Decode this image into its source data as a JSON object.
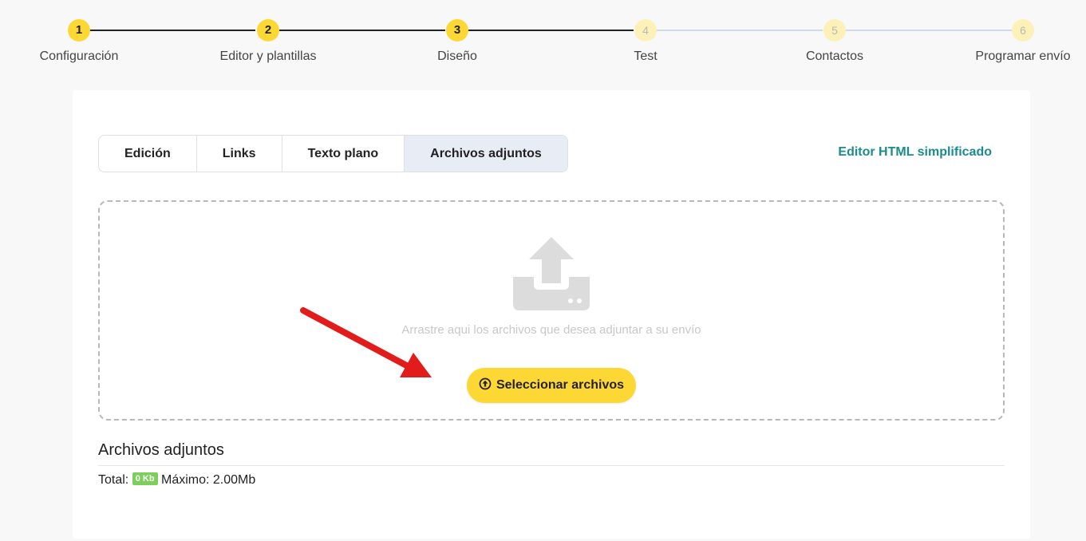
{
  "stepper": {
    "steps": [
      {
        "number": "1",
        "label": "Configuración",
        "state": "done"
      },
      {
        "number": "2",
        "label": "Editor y plantillas",
        "state": "done"
      },
      {
        "number": "3",
        "label": "Diseño",
        "state": "done"
      },
      {
        "number": "4",
        "label": "Test",
        "state": "todo"
      },
      {
        "number": "5",
        "label": "Contactos",
        "state": "todo"
      },
      {
        "number": "6",
        "label": "Programar envío",
        "state": "todo"
      }
    ]
  },
  "tabs": [
    {
      "label": "Edición",
      "active": false
    },
    {
      "label": "Links",
      "active": false
    },
    {
      "label": "Texto plano",
      "active": false
    },
    {
      "label": "Archivos adjuntos",
      "active": true
    }
  ],
  "html_editor_link": "Editor HTML simplificado",
  "dropzone": {
    "icon": "upload-tray-icon",
    "text": "Arrastre aqui los archivos que desea adjuntar a su envío",
    "button_label": "Seleccionar archivos",
    "button_icon": "upload-circle-icon"
  },
  "attachments": {
    "title": "Archivos adjuntos",
    "total_label": "Total:",
    "total_value": "0 Kb",
    "max_label": "Máximo: 2.00Mb"
  },
  "annotation": {
    "icon": "red-arrow-icon",
    "color": "#e21b1b"
  },
  "colors": {
    "accent": "#fdd835",
    "accent_light": "#fdf1b8",
    "link": "#1a8b8f",
    "badge": "#7ccf5a"
  }
}
